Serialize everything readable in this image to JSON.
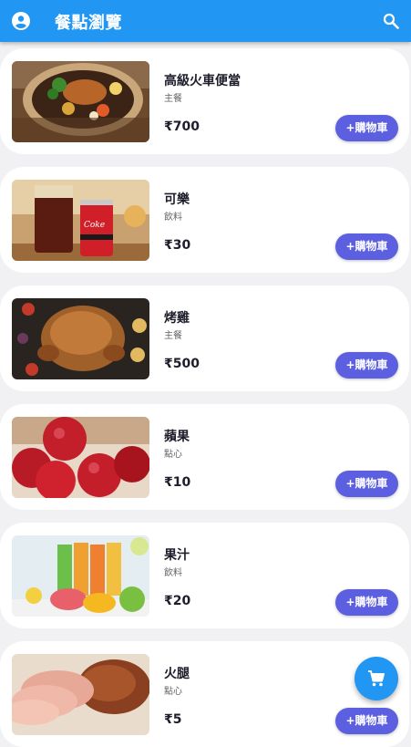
{
  "appbar": {
    "title": "餐點瀏覽",
    "left_icon": "account-circle-icon",
    "right_icon": "search-icon",
    "color": "#2196f3"
  },
  "items": [
    {
      "name": "高級火車便當",
      "category": "主餐",
      "price": "₹700",
      "button": "+購物車"
    },
    {
      "name": "可樂",
      "category": "飲料",
      "price": "₹30",
      "button": "+購物車"
    },
    {
      "name": "烤雞",
      "category": "主餐",
      "price": "₹500",
      "button": "+購物車"
    },
    {
      "name": "蘋果",
      "category": "點心",
      "price": "₹10",
      "button": "+購物車"
    },
    {
      "name": "果汁",
      "category": "飲料",
      "price": "₹20",
      "button": "+購物車"
    },
    {
      "name": "火腿",
      "category": "點心",
      "price": "₹5",
      "button": "+購物車"
    }
  ],
  "fab": {
    "icon": "shopping-cart-icon",
    "color": "#2196f3"
  },
  "colors": {
    "button": "#5c5fe0",
    "card": "#ffffff",
    "background": "#f1f1f3"
  }
}
